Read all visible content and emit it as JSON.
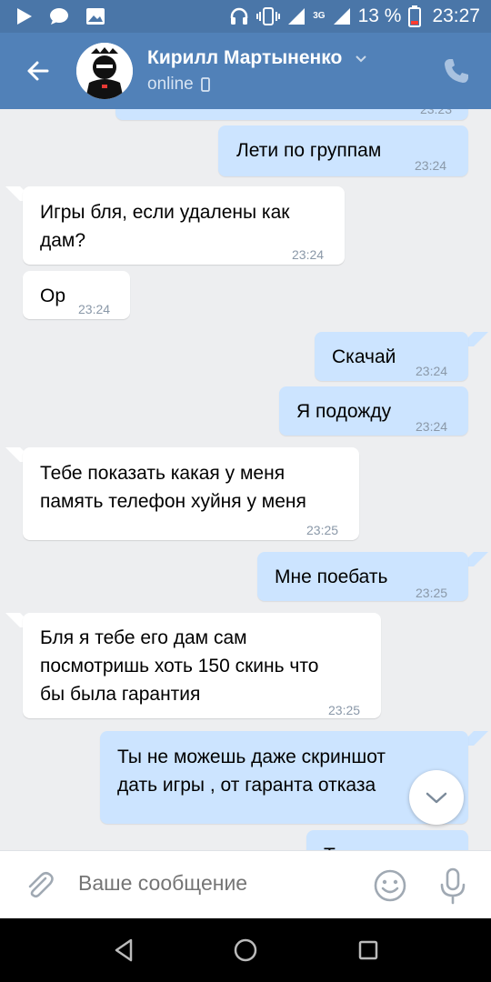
{
  "status_bar": {
    "battery_percent": "13 %",
    "time": "23:27",
    "network_type": "3G"
  },
  "header": {
    "contact_name": "Кирилл Мартыненко",
    "status": "online",
    "back_icon": "arrow-left-icon",
    "call_icon": "phone-icon"
  },
  "messages": [
    {
      "dir": "out",
      "text": "",
      "time": "23:23"
    },
    {
      "dir": "out",
      "text": "Лети по группам",
      "time": "23:24"
    },
    {
      "dir": "in",
      "text": "Игры бля, если удалены как\nдам?",
      "time": "23:24"
    },
    {
      "dir": "in",
      "text": "Ор",
      "time": "23:24"
    },
    {
      "dir": "out",
      "text": "Скачай",
      "time": "23:24"
    },
    {
      "dir": "out",
      "text": "Я подожду",
      "time": "23:24"
    },
    {
      "dir": "in",
      "text": "Тебе показать какая у меня\nпамять телефон хуйня у меня",
      "time": "23:25"
    },
    {
      "dir": "out",
      "text": "Мне поебать",
      "time": "23:25"
    },
    {
      "dir": "in",
      "text": "Бля я тебе его дам сам\nпосмотришь хоть 150 скинь что\nбы была гарантия",
      "time": "23:25"
    },
    {
      "dir": "out",
      "text": "Ты не можешь даже скриншот\nдать игры , от гаранта отказа",
      "time": ""
    },
    {
      "dir": "out",
      "text": "Т",
      "time": ""
    }
  ],
  "composer": {
    "placeholder": "Ваше сообщение"
  },
  "colors": {
    "header": "#5181b8",
    "status_bar": "#4a76a8",
    "outgoing_bubble": "#cce4ff",
    "incoming_bubble": "#ffffff",
    "background": "#edeef0"
  }
}
